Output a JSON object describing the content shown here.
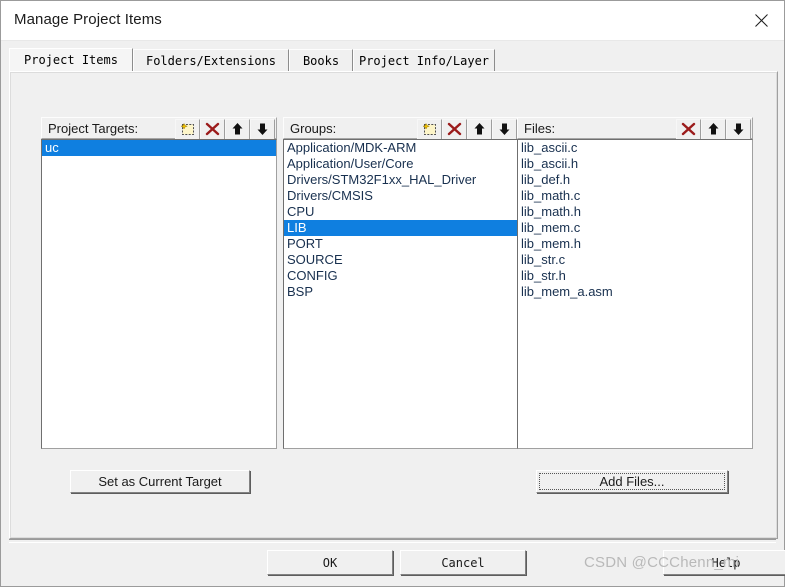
{
  "window": {
    "title": "Manage Project Items",
    "close_icon": "close-icon"
  },
  "tabs": [
    {
      "label": "Project Items",
      "active": true
    },
    {
      "label": "Folders/Extensions",
      "active": false
    },
    {
      "label": "Books",
      "active": false
    },
    {
      "label": "Project Info/Layer",
      "active": false
    }
  ],
  "panels": {
    "targets": {
      "label": "Project Targets:",
      "tools": [
        "new-icon",
        "delete-icon",
        "move-up-icon",
        "move-down-icon"
      ],
      "items": [
        "uc"
      ],
      "selected": "uc"
    },
    "groups": {
      "label": "Groups:",
      "tools": [
        "new-icon",
        "delete-icon",
        "move-up-icon",
        "move-down-icon"
      ],
      "items": [
        "Application/MDK-ARM",
        "Application/User/Core",
        "Drivers/STM32F1xx_HAL_Driver",
        "Drivers/CMSIS",
        "CPU",
        "LIB",
        "PORT",
        "SOURCE",
        "CONFIG",
        "BSP"
      ],
      "selected": "LIB"
    },
    "files": {
      "label": "Files:",
      "tools": [
        "delete-icon",
        "move-up-icon",
        "move-down-icon"
      ],
      "items": [
        "lib_ascii.c",
        "lib_ascii.h",
        "lib_def.h",
        "lib_math.c",
        "lib_math.h",
        "lib_mem.c",
        "lib_mem.h",
        "lib_str.c",
        "lib_str.h",
        "lib_mem_a.asm"
      ],
      "selected": null
    }
  },
  "buttons": {
    "set_current_target": "Set as Current Target",
    "add_files": "Add Files...",
    "ok": "OK",
    "cancel": "Cancel",
    "help": "Help"
  },
  "watermark": "CSDN @CCChenn_mi",
  "colors": {
    "selection": "#0f7fe0",
    "dialog_face": "#f0f0f0",
    "list_text": "#18304f",
    "delete_icon": "#9b1b1b",
    "watermark": "#b9b9b9"
  }
}
